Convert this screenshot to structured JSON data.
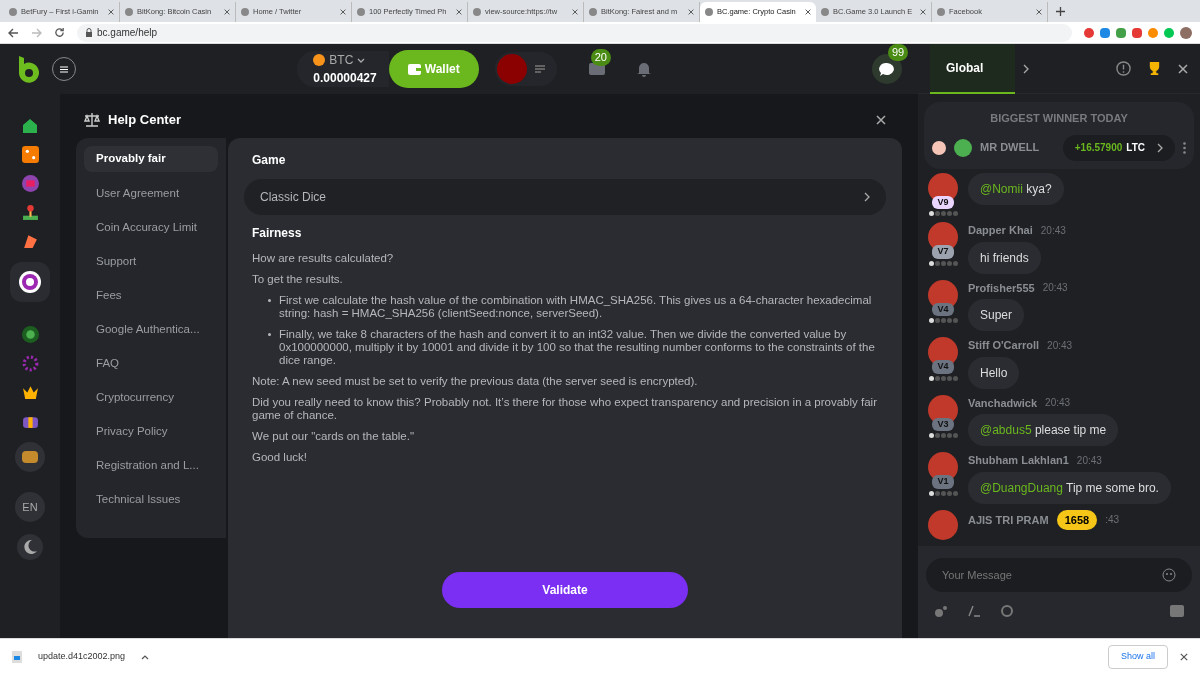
{
  "browser": {
    "tabs": [
      {
        "title": "BetFury – First i-Gamin",
        "selected": false
      },
      {
        "title": "BitKong: Bitcoin Casin",
        "selected": false
      },
      {
        "title": "Home / Twitter",
        "selected": false
      },
      {
        "title": "100 Perfectly Timed Ph",
        "selected": false
      },
      {
        "title": "view-source:https://tw",
        "selected": false
      },
      {
        "title": "BitKong: Fairest and m",
        "selected": false
      },
      {
        "title": "BC.game: Crypto Casin",
        "selected": true
      },
      {
        "title": "BC.Game 3.0 Launch E",
        "selected": false
      },
      {
        "title": "Facebook",
        "selected": false
      }
    ],
    "address": "bc.game/help"
  },
  "topbar": {
    "currency": "BTC",
    "balance": "0.00000427",
    "wallet_button": "Wallet",
    "mail_count": "20",
    "chat_count": "99"
  },
  "rail": {
    "language": "EN"
  },
  "help": {
    "title": "Help Center",
    "menu": [
      {
        "label": "Provably fair",
        "selected": true
      },
      {
        "label": "User Agreement",
        "selected": false
      },
      {
        "label": "Coin Accuracy Limit",
        "selected": false
      },
      {
        "label": "Support",
        "selected": false
      },
      {
        "label": "Fees",
        "selected": false
      },
      {
        "label": "Google Authentica...",
        "selected": false
      },
      {
        "label": "FAQ",
        "selected": false
      },
      {
        "label": "Cryptocurrency",
        "selected": false
      },
      {
        "label": "Privacy Policy",
        "selected": false
      },
      {
        "label": "Registration and L...",
        "selected": false
      },
      {
        "label": "Technical Issues",
        "selected": false
      }
    ],
    "game_label": "Game",
    "game_value": "Classic Dice",
    "fairness_label": "Fairness",
    "paragraphs_before": [
      "How are results calculated?",
      "To get the results."
    ],
    "bullets": [
      "First we calculate the hash value of the combination with HMAC_SHA256. This gives us a 64-character hexadecimal string: hash = HMAC_SHA256 (clientSeed:nonce, serverSeed).",
      "Finally, we take 8 characters of the hash and convert it to an int32 value. Then we divide the converted value by 0x100000000, multiply it by 10001 and divide it by 100 so that the resulting number conforms to the constraints of the dice range."
    ],
    "paragraphs_after": [
      "Note: A new seed must be set to verify the previous data (the server seed is encrypted).",
      "Did you really need to know this? Probably not. It’s there for those who expect transparency and precision in a provably fair game of chance.",
      "We put our \"cards on the table.\"",
      "Good luck!"
    ],
    "validate_button": "Validate"
  },
  "chat": {
    "tab": "Global",
    "winner_title": "BIGGEST WINNER TODAY",
    "winner_name": "MR DWELL",
    "winner_amount": "+16.57900",
    "winner_coin": "LTC",
    "messages": [
      {
        "level": "V9",
        "mention": "@Nomii",
        "text": "kya?",
        "color": "#e9d5ff"
      },
      {
        "name": "Dapper Khai",
        "time": "20:43",
        "level": "V7",
        "text": "hi friends",
        "color": "#9ca3af"
      },
      {
        "name": "Profisher555",
        "time": "20:43",
        "level": "V4",
        "text": "Super",
        "color": "#6b7280"
      },
      {
        "name": "Stiff O'Carroll",
        "time": "20:43",
        "level": "V4",
        "text": "Hello",
        "color": "#6b7280"
      },
      {
        "name": "Vanchadwick",
        "time": "20:43",
        "level": "V3",
        "mention": "@abdus5",
        "text": "please tip me",
        "color": "#6b7280"
      },
      {
        "name": "Shubham Lakhlan1",
        "time": "20:43",
        "level": "V1",
        "mention": "@DuangDuang",
        "text": "Tip me some bro.",
        "color": "#6b7280"
      },
      {
        "name": "AJIS TRI PRAM",
        "time": ":43"
      }
    ],
    "unread_badge": "1658",
    "input_placeholder": "Your Message"
  },
  "downloads": {
    "file": "update.d41c2002.png",
    "show_all": "Show all"
  }
}
